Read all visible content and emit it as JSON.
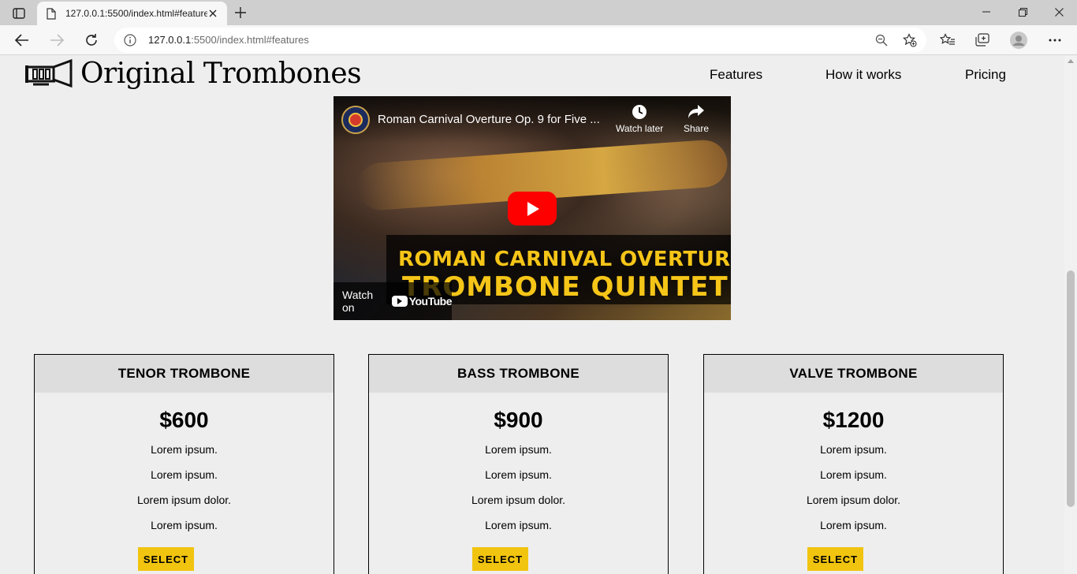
{
  "browser": {
    "tab_title": "127.0.0.1:5500/index.html#features",
    "url_host": "127.0.0.1",
    "url_rest": ":5500/index.html#features"
  },
  "header": {
    "logo_text": "Original Trombones",
    "nav": [
      {
        "label": "Features"
      },
      {
        "label": "How it works"
      },
      {
        "label": "Pricing"
      }
    ]
  },
  "video": {
    "title": "Roman Carnival Overture Op. 9 for Five ...",
    "watch_later": "Watch later",
    "share": "Share",
    "caption_line1": "ROMAN CARNIVAL OVERTURE",
    "caption_line2": "TROMBONE QUINTET",
    "watch_on": "Watch on",
    "youtube": "YouTube"
  },
  "pricing": [
    {
      "name": "TENOR TROMBONE",
      "price": "$600",
      "features": [
        "Lorem ipsum.",
        "Lorem ipsum.",
        "Lorem ipsum dolor.",
        "Lorem ipsum."
      ],
      "button": "SELECT"
    },
    {
      "name": "BASS TROMBONE",
      "price": "$900",
      "features": [
        "Lorem ipsum.",
        "Lorem ipsum.",
        "Lorem ipsum dolor.",
        "Lorem ipsum."
      ],
      "button": "SELECT"
    },
    {
      "name": "VALVE TROMBONE",
      "price": "$1200",
      "features": [
        "Lorem ipsum.",
        "Lorem ipsum.",
        "Lorem ipsum dolor.",
        "Lorem ipsum."
      ],
      "button": "SELECT"
    }
  ],
  "colors": {
    "page_bg": "#eeeeee",
    "card_header_bg": "#dddddd",
    "button_bg": "#f1c40f",
    "play_button": "#ff0000",
    "caption_text": "#f5c518"
  }
}
